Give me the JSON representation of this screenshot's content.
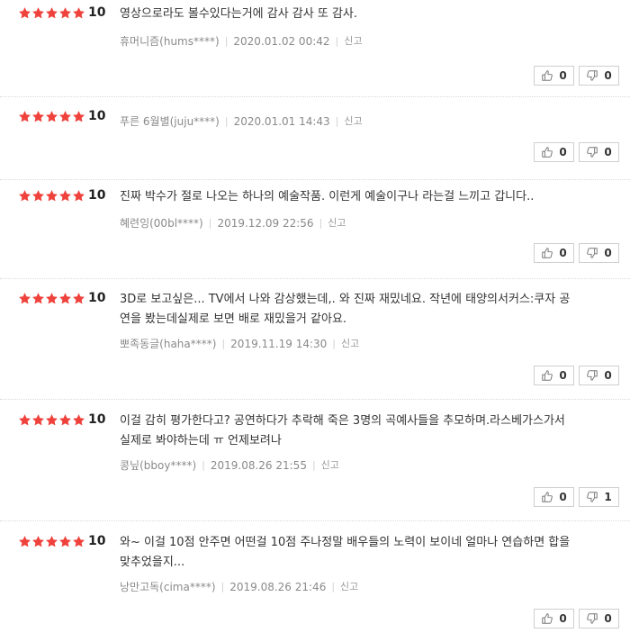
{
  "colors": {
    "star": "#f0423c",
    "text": "#333333",
    "meta": "#999999"
  },
  "icons": {
    "star": "star-icon",
    "like": "thumbs-up-icon",
    "dislike": "thumbs-down-icon"
  },
  "reviews": [
    {
      "stars": 5,
      "score": "10",
      "lines": [
        "영상으로라도 볼수있다는거에 감사 감사 또 감사."
      ],
      "nickname": "휴머니즘(hums****)",
      "date": "2020.01.02 00:42",
      "report": "신고",
      "likes": "0",
      "dislikes": "0"
    },
    {
      "stars": 5,
      "score": "10",
      "lines": [
        "푸른 6월별(juju****)"
      ],
      "is_meta_only": true,
      "nickname": "푸른 6월별(juju****)",
      "date": "2020.01.01 14:43",
      "report": "신고",
      "likes": "0",
      "dislikes": "0"
    },
    {
      "stars": 5,
      "score": "10",
      "lines": [
        "진짜 박수가 절로 나오는 하나의 예술작품. 이런게 예술이구나 라는걸 느끼고 갑니다.."
      ],
      "nickname": "혜련잉(00bl****)",
      "date": "2019.12.09 22:56",
      "report": "신고",
      "likes": "0",
      "dislikes": "0"
    },
    {
      "stars": 5,
      "score": "10",
      "lines": [
        "3D로 보고싶은... TV에서 나와 감상했는데,. 와 진짜 재밌네요. 작년에 태양의서커스:쿠자 공",
        "연을 봤는데실제로 보면 배로 재밌을거 같아요."
      ],
      "nickname": "뽀족동글(haha****)",
      "date": "2019.11.19 14:30",
      "report": "신고",
      "likes": "0",
      "dislikes": "0"
    },
    {
      "stars": 5,
      "score": "10",
      "lines": [
        "이걸 감히 평가한다고? 공연하다가 추락해 죽은 3명의 곡예사들을 추모하며.라스베가스가서",
        "실제로 봐야하는데 ㅠ 언제보려나"
      ],
      "nickname": "콩닢(bboy****)",
      "date": "2019.08.26 21:55",
      "report": "신고",
      "likes": "0",
      "dislikes": "1"
    },
    {
      "stars": 5,
      "score": "10",
      "lines": [
        "와~ 이걸 10점 안주면 어떤걸 10점 주나정말 배우들의 노력이 보이네 얼마나 연습하면 합을",
        "맞추었을지..."
      ],
      "nickname": "낭만고독(cima****)",
      "date": "2019.08.26 21:46",
      "report": "신고",
      "likes": "0",
      "dislikes": "0"
    }
  ]
}
